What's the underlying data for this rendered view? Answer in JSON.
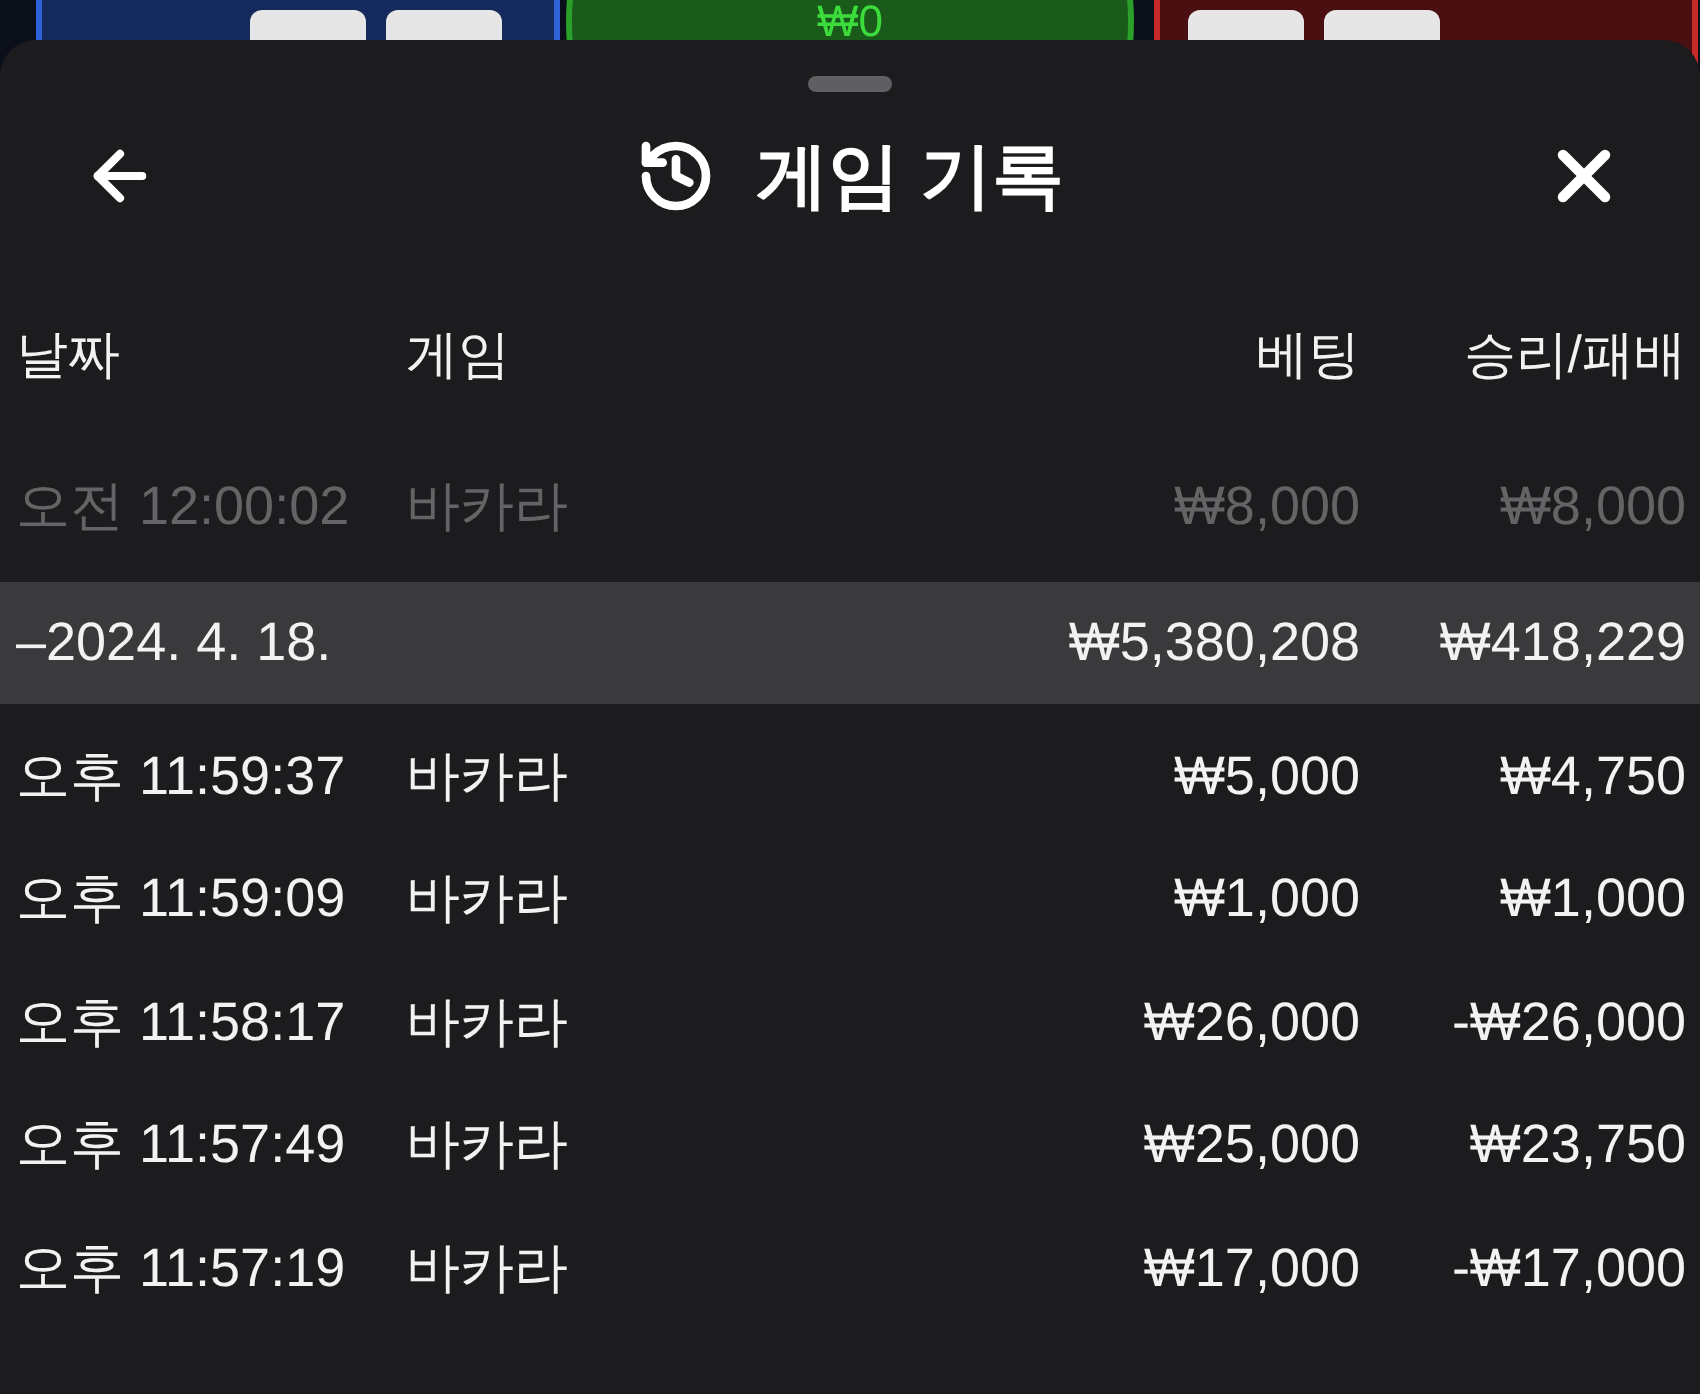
{
  "background": {
    "bet_amount": "₩0"
  },
  "sheet": {
    "title": "게임 기록"
  },
  "table": {
    "columns": [
      "날짜",
      "게임",
      "베팅",
      "승리/패배"
    ],
    "rows": [
      {
        "kind": "bet",
        "dimmed": true,
        "time": "오전 12:00:02",
        "game": "바카라",
        "bet": "₩8,000",
        "result": "₩8,000"
      },
      {
        "kind": "date",
        "date": "–2024. 4. 18.",
        "bet": "₩5,380,208",
        "result": "₩418,229"
      },
      {
        "kind": "bet",
        "dimmed": false,
        "time": "오후 11:59:37",
        "game": "바카라",
        "bet": "₩5,000",
        "result": "₩4,750"
      },
      {
        "kind": "bet",
        "dimmed": false,
        "time": "오후 11:59:09",
        "game": "바카라",
        "bet": "₩1,000",
        "result": "₩1,000"
      },
      {
        "kind": "bet",
        "dimmed": false,
        "time": "오후 11:58:17",
        "game": "바카라",
        "bet": "₩26,000",
        "result": "-₩26,000"
      },
      {
        "kind": "bet",
        "dimmed": false,
        "time": "오후 11:57:49",
        "game": "바카라",
        "bet": "₩25,000",
        "result": "₩23,750"
      },
      {
        "kind": "bet",
        "dimmed": false,
        "time": "오후 11:57:19",
        "game": "바카라",
        "bet": "₩17,000",
        "result": "-₩17,000"
      }
    ]
  }
}
